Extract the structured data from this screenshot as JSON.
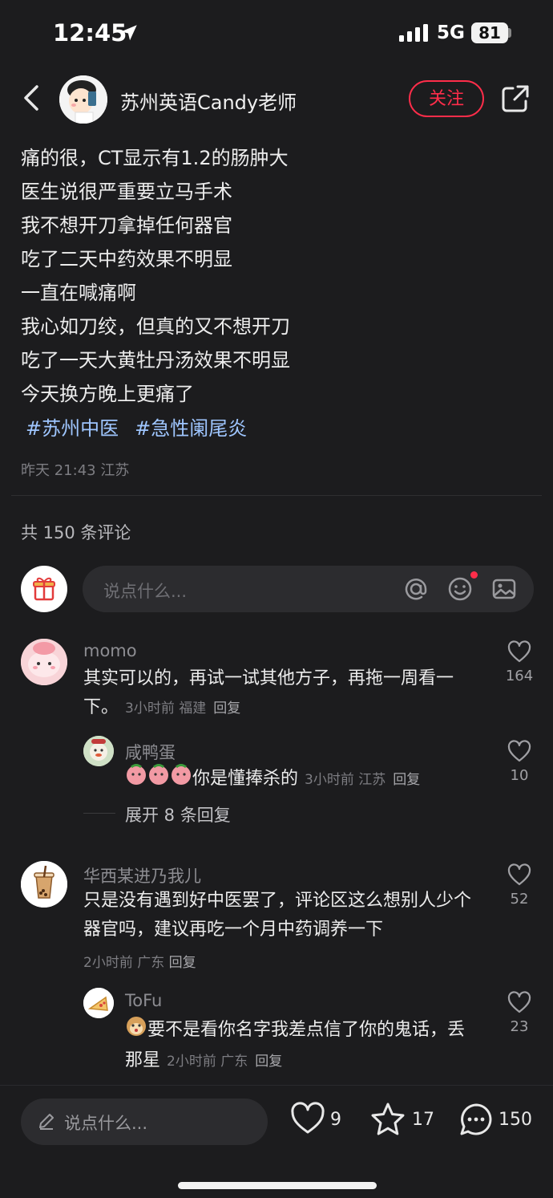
{
  "status": {
    "time": "12:45",
    "network": "5G",
    "battery": "81"
  },
  "header": {
    "author": "苏州英语Candy老师",
    "follow_label": "关注"
  },
  "post": {
    "lines": [
      "痛的很，CT显示有1.2的肠肿大",
      "医生说很严重要立马手术",
      "我不想开刀拿掉任何器官",
      "吃了二天中药效果不明显",
      "一直在喊痛啊",
      "我心如刀绞，但真的又不想开刀",
      "吃了一天大黄牡丹汤效果不明显",
      "今天换方晚上更痛了"
    ],
    "tags": [
      "#苏州中医",
      "#急性阑尾炎"
    ],
    "meta": "昨天 21:43 江苏"
  },
  "comments_count": "共 150 条评论",
  "comment_input": {
    "placeholder": "说点什么..."
  },
  "comments": [
    {
      "user": "momo",
      "text_line1": "其实可以的，再试一试其他方子，再拖一周看一",
      "text_line2": "下。",
      "meta": "3小时前 福建",
      "reply_label": "回复",
      "likes": "164",
      "reply": {
        "user": "咸鸭蛋",
        "text": "你是懂捧杀的",
        "meta": "3小时前 江苏",
        "reply_label": "回复",
        "likes": "10"
      },
      "expand_label": "展开 8 条回复"
    },
    {
      "user": "华西某进乃我儿",
      "text_line1": "只是没有遇到好中医罢了，评论区这么想别人少个",
      "text_line2": "器官吗，建议再吃一个月中药调养一下",
      "meta": "2小时前 广东",
      "reply_label": "回复",
      "likes": "52",
      "reply": {
        "user": "ToFu",
        "text_line1": "要不是看你名字我差点信了你的鬼话，丢",
        "text_line2": "那星",
        "meta": "2小时前 广东",
        "reply_label": "回复",
        "likes": "23"
      }
    }
  ],
  "bottom_bar": {
    "placeholder": "说点什么...",
    "likes": "9",
    "stars": "17",
    "comments": "150"
  },
  "colors": {
    "accent": "#ff2d4a",
    "tag": "#9fc6ff",
    "background": "#1c1c1e"
  }
}
